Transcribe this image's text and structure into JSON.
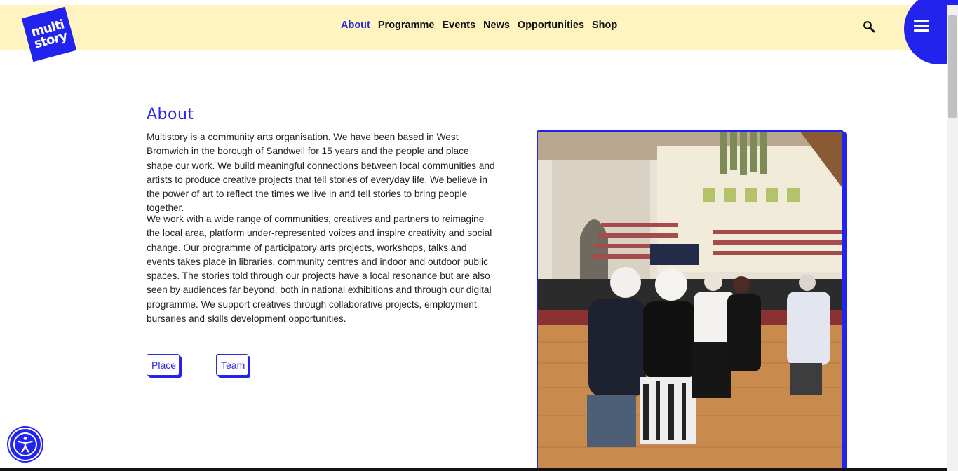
{
  "brand": {
    "logo_line1": "multi",
    "logo_line2": "story",
    "accent": "#2323ee",
    "header_bg": "#fff3bf"
  },
  "nav": {
    "items": [
      {
        "label": "About",
        "active": true
      },
      {
        "label": "Programme"
      },
      {
        "label": "Events"
      },
      {
        "label": "News"
      },
      {
        "label": "Opportunities"
      },
      {
        "label": "Shop"
      }
    ]
  },
  "icons": {
    "search": "search-icon",
    "menu": "hamburger-menu-icon",
    "accessibility": "accessibility-icon"
  },
  "main": {
    "title": "About",
    "paragraphs": [
      "Multistory is a community arts organisation. We have been based in West Bromwich in the borough of Sandwell for 15 years and the people and place shape our work. We build meaningful connections between local communities and artists to produce creative projects that tell stories of everyday life. We believe in the power of art to reflect the times we live in and tell stories to bring people together.",
      "We work with a wide range of communities, creatives and partners to reimagine the local area, platform under-represented voices and inspire creativity and social change. Our programme of participatory arts projects, workshops, talks and events takes place in libraries, community centres and indoor and outdoor public spaces. The stories told through our projects have a local resonance but are also seen by audiences far beyond, both in national exhibitions and through our digital programme. We support creatives through collaborative projects, employment, bursaries and skills development opportunities."
    ],
    "buttons": {
      "place": "Place",
      "team": "Team"
    }
  }
}
